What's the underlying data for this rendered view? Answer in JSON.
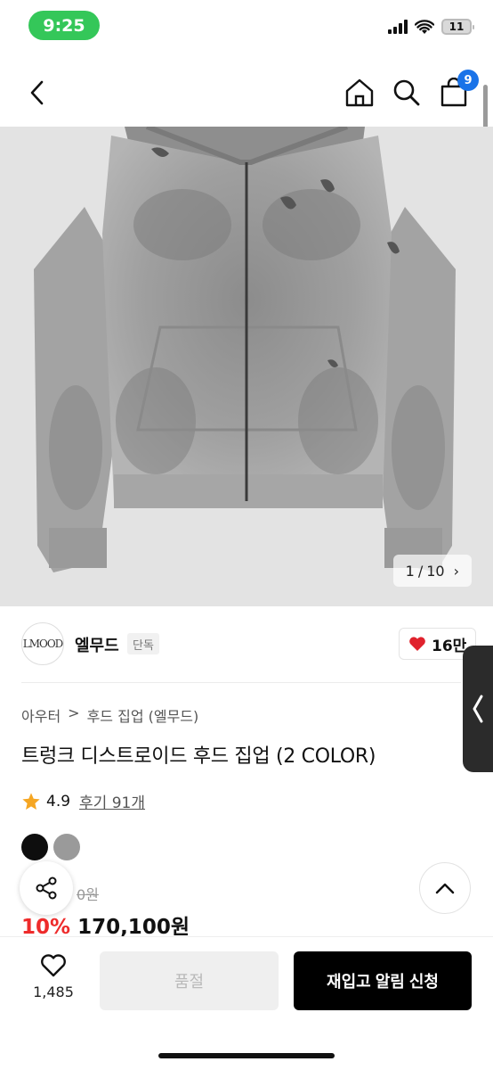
{
  "status": {
    "time": "9:25",
    "battery": "11"
  },
  "header": {
    "cart_count": "9"
  },
  "gallery": {
    "current": "1",
    "total": "10",
    "separator": "/",
    "next_glyph": "›"
  },
  "brand": {
    "name": "엘무드",
    "tag": "단독",
    "logo_text": "LMOOD",
    "likes": "16만"
  },
  "breadcrumb": {
    "category": "아우터",
    "separator": ">",
    "subcategory": "후드 집업 (엘무드)"
  },
  "product": {
    "title": "트렁크 디스트로이드 후드 집업 (2 COLOR)",
    "rating": "4.9",
    "reviews": "후기 91개",
    "colors": [
      "black",
      "gray"
    ],
    "original_price": "0원",
    "discount": "10%",
    "price": "170,100원"
  },
  "bottom": {
    "wish_count": "1,485",
    "soldout_label": "품절",
    "restock_label": "재입고 알림 신청"
  },
  "colors": {
    "status_green": "#34c759",
    "badge_blue": "#1a73e8",
    "discount_red": "#ee2b2b",
    "heart_red": "#e0222d"
  }
}
